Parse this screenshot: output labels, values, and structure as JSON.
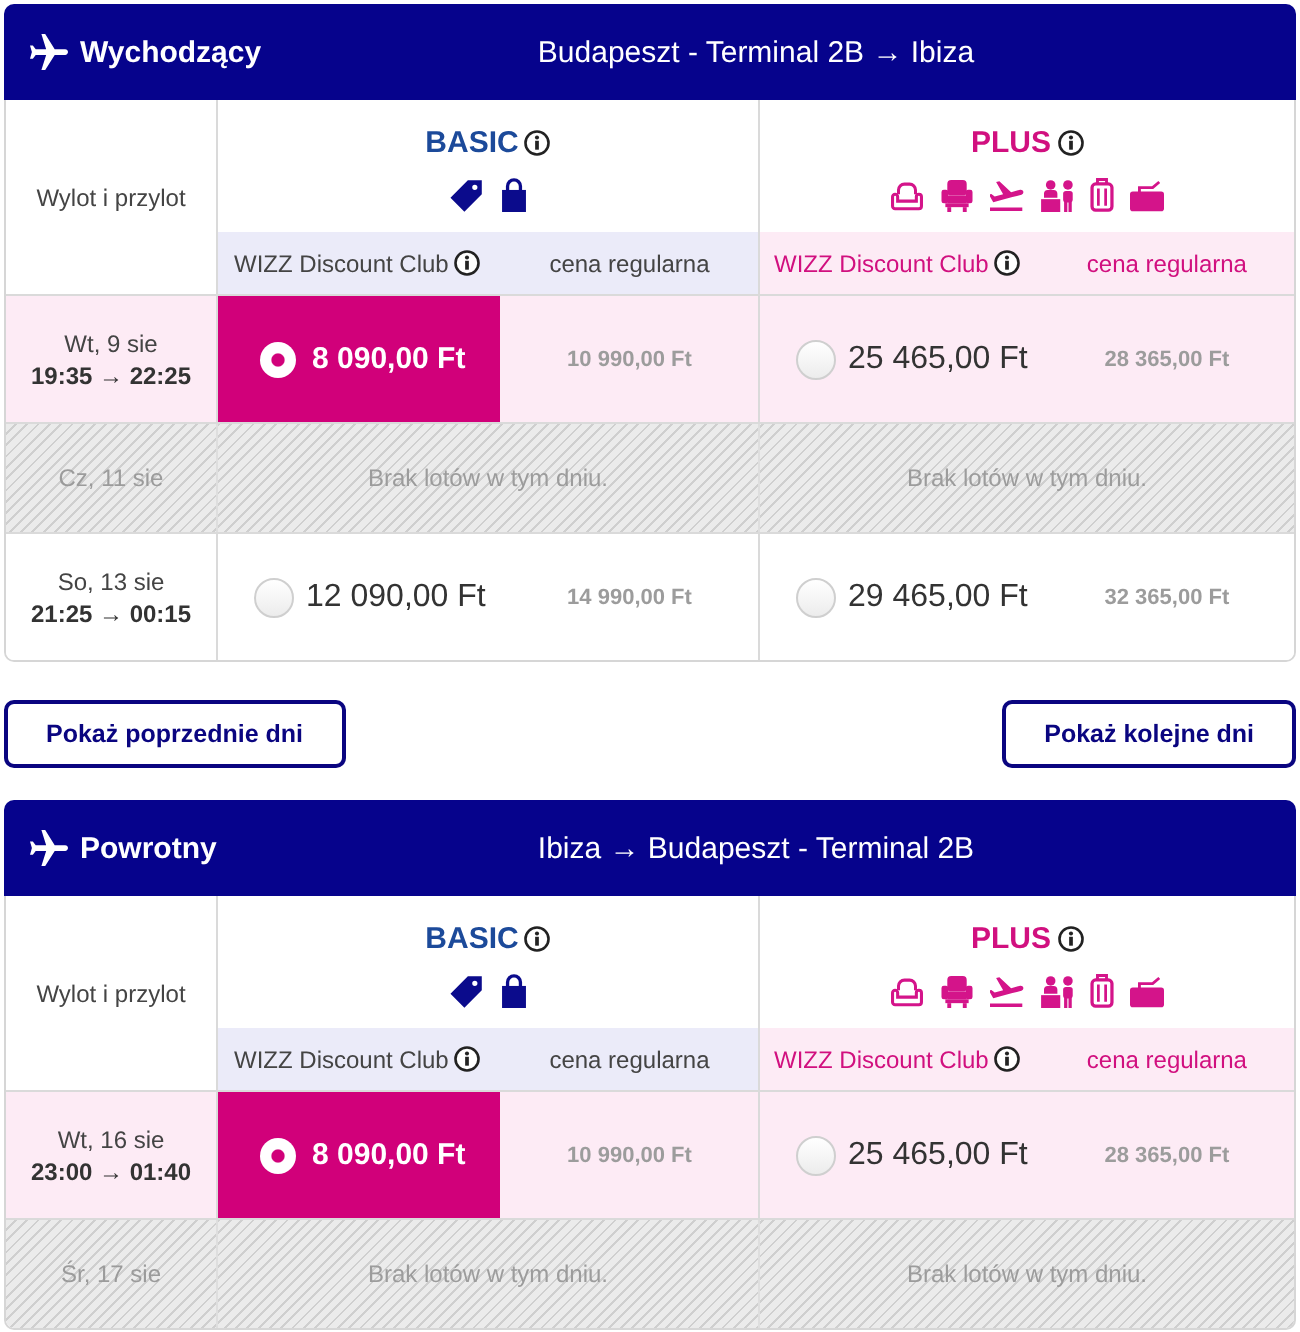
{
  "outbound": {
    "title": "Wychodzący",
    "route": "Budapeszt - Terminal 2B → Ibiza",
    "time_column": "Wylot i przylot",
    "fares": [
      {
        "kind": "basic",
        "name": "BASIC",
        "club_label": "WIZZ Discount Club",
        "regular_label": "cena regularna"
      },
      {
        "kind": "plus",
        "name": "PLUS",
        "club_label": "WIZZ Discount Club",
        "regular_label": "cena regularna"
      }
    ],
    "rows": [
      {
        "kind": "flight",
        "date": "Wt, 9 sie",
        "times": "19:35 → 22:25",
        "prices": [
          {
            "club": "8 090,00 Ft",
            "regular": "10 990,00 Ft",
            "selected": true
          },
          {
            "club": "25 465,00 Ft",
            "regular": "28 365,00 Ft",
            "selected": false
          }
        ]
      },
      {
        "kind": "no_flights",
        "date": "Cz, 11 sie",
        "messages": [
          "Brak lotów w tym dniu.",
          "Brak lotów w tym dniu."
        ]
      },
      {
        "kind": "flight",
        "date": "So, 13 sie",
        "times": "21:25 → 00:15",
        "prices": [
          {
            "club": "12 090,00 Ft",
            "regular": "14 990,00 Ft",
            "selected": false
          },
          {
            "club": "29 465,00 Ft",
            "regular": "32 365,00 Ft",
            "selected": false
          }
        ]
      }
    ]
  },
  "day_buttons": [
    {
      "label": "Pokaż poprzednie dni"
    },
    {
      "label": "Pokaż kolejne dni"
    }
  ],
  "inbound": {
    "title": "Powrotny",
    "route": "Ibiza → Budapeszt - Terminal 2B",
    "time_column": "Wylot i przylot",
    "fares": [
      {
        "kind": "basic",
        "name": "BASIC",
        "club_label": "WIZZ Discount Club",
        "regular_label": "cena regularna"
      },
      {
        "kind": "plus",
        "name": "PLUS",
        "club_label": "WIZZ Discount Club",
        "regular_label": "cena regularna"
      }
    ],
    "rows": [
      {
        "kind": "flight",
        "date": "Wt, 16 sie",
        "times": "23:00 → 01:40",
        "prices": [
          {
            "club": "8 090,00 Ft",
            "regular": "10 990,00 Ft",
            "selected": true
          },
          {
            "club": "25 465,00 Ft",
            "regular": "28 365,00 Ft",
            "selected": false
          }
        ]
      },
      {
        "kind": "no_flights",
        "date": "Śr, 17 sie",
        "messages": [
          "Brak lotów w tym dniu.",
          "Brak lotów w tym dniu."
        ]
      }
    ]
  }
}
